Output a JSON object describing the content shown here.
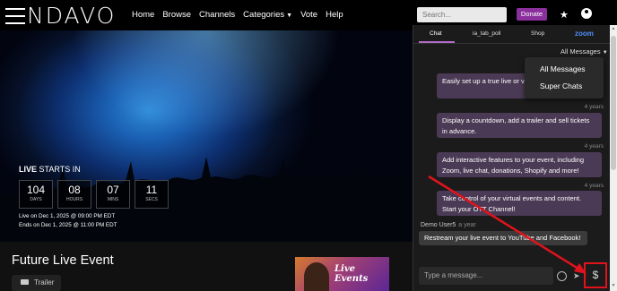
{
  "header": {
    "logo": "ENDAVO",
    "nav": [
      "Home",
      "Browse",
      "Channels",
      "Categories",
      "Vote",
      "Help"
    ],
    "search_placeholder": "Search...",
    "donate_label": "Donate"
  },
  "hero": {
    "live_label": "LIVE",
    "starts_in": "STARTS IN",
    "countdown": [
      {
        "value": "104",
        "unit": "DAYS"
      },
      {
        "value": "08",
        "unit": "HOURS"
      },
      {
        "value": "07",
        "unit": "MINS"
      },
      {
        "value": "11",
        "unit": "SECS"
      }
    ],
    "live_on": "Live on Dec 1, 2025 @ 09:00 PM EDT",
    "ends_on": "Ends on Dec 1, 2025 @ 11:00 PM EDT"
  },
  "event": {
    "title": "Future Live Event",
    "trailer_label": "Trailer",
    "poster_text_1": "Live",
    "poster_text_2": "Events"
  },
  "chat": {
    "tabs": [
      "Chat",
      "ia_tab_poll",
      "Shop",
      "zoom"
    ],
    "filter_label": "All Messages",
    "dropdown": [
      "All Messages",
      "Super Chats"
    ],
    "messages": [
      {
        "text": "Easily set up a true live or v... stream it on Endavo.",
        "ago": "4 years"
      },
      {
        "text": "Display a countdown, add a trailer and sell tickets in advance.",
        "ago": "4 years"
      },
      {
        "text": "Add interactive features to your event, including Zoom, live chat, donations, Shopify and more!",
        "ago": "4 years"
      },
      {
        "text": "Take control of your virtual events and content. Start your OTT Channel!",
        "ago": "4 years"
      }
    ],
    "demo_user": "Demo User5",
    "demo_ago": "a year",
    "demo_message": "Restream your live event to YouTube and Facebook!",
    "input_placeholder": "Type a message...",
    "dollar_label": "$"
  },
  "colors": {
    "accent": "#8b2f9c",
    "bubble": "#4b3a55",
    "annotation": "#e0131c",
    "zoom": "#4f8ff7"
  }
}
